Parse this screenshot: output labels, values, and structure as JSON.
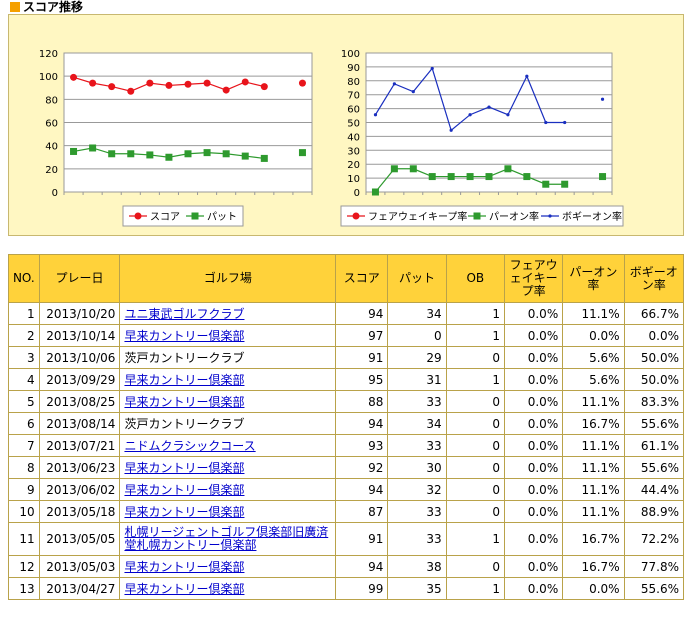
{
  "section_title": "スコア推移",
  "chart_data": [
    {
      "type": "line",
      "x": [
        1,
        2,
        3,
        4,
        5,
        6,
        7,
        8,
        9,
        10,
        11,
        12,
        13
      ],
      "ylim": [
        0,
        120
      ],
      "yticks": [
        0,
        20,
        40,
        60,
        80,
        100,
        120
      ],
      "grid": true,
      "legend": "bottom",
      "series": [
        {
          "name": "スコア",
          "color": "#e8141b",
          "values": [
            99,
            94,
            91,
            87,
            94,
            92,
            93,
            94,
            88,
            95,
            91,
            null,
            94
          ]
        },
        {
          "name": "パット",
          "color": "#2e9a2e",
          "values": [
            35,
            38,
            33,
            33,
            32,
            30,
            33,
            34,
            33,
            31,
            29,
            null,
            34
          ]
        }
      ]
    },
    {
      "type": "line",
      "x": [
        1,
        2,
        3,
        4,
        5,
        6,
        7,
        8,
        9,
        10,
        11,
        12,
        13
      ],
      "ylim": [
        0,
        100
      ],
      "yticks": [
        0,
        10,
        20,
        30,
        40,
        50,
        60,
        70,
        80,
        90,
        100
      ],
      "grid": true,
      "legend": "bottom",
      "series": [
        {
          "name": "フェアウェイキープ率",
          "color": "#e8141b",
          "values": [
            null,
            null,
            null,
            null,
            null,
            null,
            null,
            null,
            null,
            null,
            null,
            null,
            null
          ]
        },
        {
          "name": "パーオン率",
          "color": "#2e9a2e",
          "values": [
            0,
            16.7,
            16.7,
            11.1,
            11.1,
            11.1,
            11.1,
            16.7,
            11.1,
            5.6,
            5.6,
            null,
            11.1
          ]
        },
        {
          "name": "ボギーオン率",
          "color": "#1a2fbf",
          "values": [
            55.6,
            77.8,
            72.2,
            88.9,
            44.4,
            55.6,
            61.1,
            55.6,
            83.3,
            50.0,
            50.0,
            null,
            66.7
          ]
        }
      ]
    }
  ],
  "table": {
    "headers": [
      "NO.",
      "プレー日",
      "ゴルフ場",
      "スコア",
      "パット",
      "OB",
      "フェアウェイキープ率",
      "パーオン率",
      "ボギーオン率"
    ],
    "header_lines": [
      [
        "NO."
      ],
      [
        "プレー日"
      ],
      [
        "ゴルフ場"
      ],
      [
        "スコア"
      ],
      [
        "パット"
      ],
      [
        "OB"
      ],
      [
        "フェアウ",
        "ェイキー",
        "プ率"
      ],
      [
        "パーオン",
        "率"
      ],
      [
        "ボギーオ",
        "ン率"
      ]
    ],
    "rows": [
      {
        "no": "1",
        "date": "2013/10/20",
        "course": "ユニ東武ゴルフクラブ",
        "link": true,
        "score": "94",
        "putt": "34",
        "ob": "1",
        "fw": "0.0%",
        "par_on": "11.1%",
        "bogey_on": "66.7%"
      },
      {
        "no": "2",
        "date": "2013/10/14",
        "course": "早来カントリー倶楽部",
        "link": true,
        "score": "97",
        "putt": "0",
        "ob": "1",
        "fw": "0.0%",
        "par_on": "0.0%",
        "bogey_on": "0.0%"
      },
      {
        "no": "3",
        "date": "2013/10/06",
        "course": "茨戸カントリークラブ",
        "link": false,
        "score": "91",
        "putt": "29",
        "ob": "0",
        "fw": "0.0%",
        "par_on": "5.6%",
        "bogey_on": "50.0%"
      },
      {
        "no": "4",
        "date": "2013/09/29",
        "course": "早来カントリー倶楽部",
        "link": true,
        "score": "95",
        "putt": "31",
        "ob": "1",
        "fw": "0.0%",
        "par_on": "5.6%",
        "bogey_on": "50.0%"
      },
      {
        "no": "5",
        "date": "2013/08/25",
        "course": "早来カントリー倶楽部",
        "link": true,
        "score": "88",
        "putt": "33",
        "ob": "0",
        "fw": "0.0%",
        "par_on": "11.1%",
        "bogey_on": "83.3%"
      },
      {
        "no": "6",
        "date": "2013/08/14",
        "course": "茨戸カントリークラブ",
        "link": false,
        "score": "94",
        "putt": "34",
        "ob": "0",
        "fw": "0.0%",
        "par_on": "16.7%",
        "bogey_on": "55.6%"
      },
      {
        "no": "7",
        "date": "2013/07/21",
        "course": "ニドムクラシックコース",
        "link": true,
        "score": "93",
        "putt": "33",
        "ob": "0",
        "fw": "0.0%",
        "par_on": "11.1%",
        "bogey_on": "61.1%"
      },
      {
        "no": "8",
        "date": "2013/06/23",
        "course": "早来カントリー倶楽部",
        "link": true,
        "score": "92",
        "putt": "30",
        "ob": "0",
        "fw": "0.0%",
        "par_on": "11.1%",
        "bogey_on": "55.6%"
      },
      {
        "no": "9",
        "date": "2013/06/02",
        "course": "早来カントリー倶楽部",
        "link": true,
        "score": "94",
        "putt": "32",
        "ob": "0",
        "fw": "0.0%",
        "par_on": "11.1%",
        "bogey_on": "44.4%"
      },
      {
        "no": "10",
        "date": "2013/05/18",
        "course": "早来カントリー倶楽部",
        "link": true,
        "score": "87",
        "putt": "33",
        "ob": "0",
        "fw": "0.0%",
        "par_on": "11.1%",
        "bogey_on": "88.9%"
      },
      {
        "no": "11",
        "date": "2013/05/05",
        "course": "札幌リージェントゴルフ倶楽部旧廣済堂札幌カントリー倶楽部",
        "link": true,
        "score": "91",
        "putt": "33",
        "ob": "1",
        "fw": "0.0%",
        "par_on": "16.7%",
        "bogey_on": "72.2%"
      },
      {
        "no": "12",
        "date": "2013/05/03",
        "course": "早来カントリー倶楽部",
        "link": true,
        "score": "94",
        "putt": "38",
        "ob": "0",
        "fw": "0.0%",
        "par_on": "16.7%",
        "bogey_on": "77.8%"
      },
      {
        "no": "13",
        "date": "2013/04/27",
        "course": "早来カントリー倶楽部",
        "link": true,
        "score": "99",
        "putt": "35",
        "ob": "1",
        "fw": "0.0%",
        "par_on": "0.0%",
        "bogey_on": "55.6%"
      }
    ]
  }
}
